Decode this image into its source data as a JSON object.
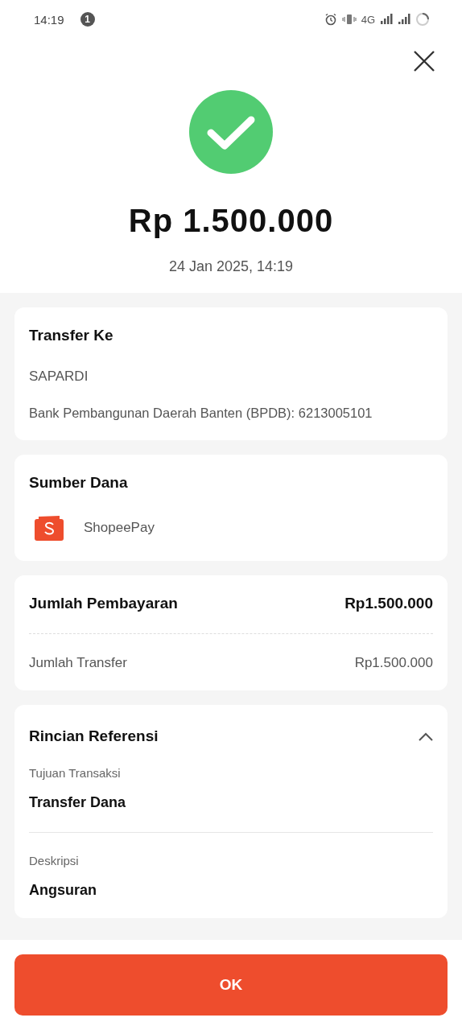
{
  "status_bar": {
    "time": "14:19",
    "notification_count": "1",
    "network": "4G"
  },
  "header": {
    "amount": "Rp 1.500.000",
    "datetime": "24 Jan 2025, 14:19"
  },
  "transfer_to": {
    "title": "Transfer Ke",
    "name": "SAPARDI",
    "bank": "Bank Pembangunan Daerah Banten (BPDB): 6213005101"
  },
  "source": {
    "title": "Sumber Dana",
    "method": "ShopeePay"
  },
  "payment": {
    "total_label": "Jumlah Pembayaran",
    "total_value": "Rp1.500.000",
    "rows": [
      {
        "label": "Jumlah Transfer",
        "value": "Rp1.500.000"
      }
    ]
  },
  "reference": {
    "title": "Rincian Referensi",
    "expanded": true,
    "fields": [
      {
        "label": "Tujuan Transaksi",
        "value": "Transfer Dana"
      },
      {
        "label": "Deskripsi",
        "value": "Angsuran"
      }
    ]
  },
  "ok_button": "OK"
}
